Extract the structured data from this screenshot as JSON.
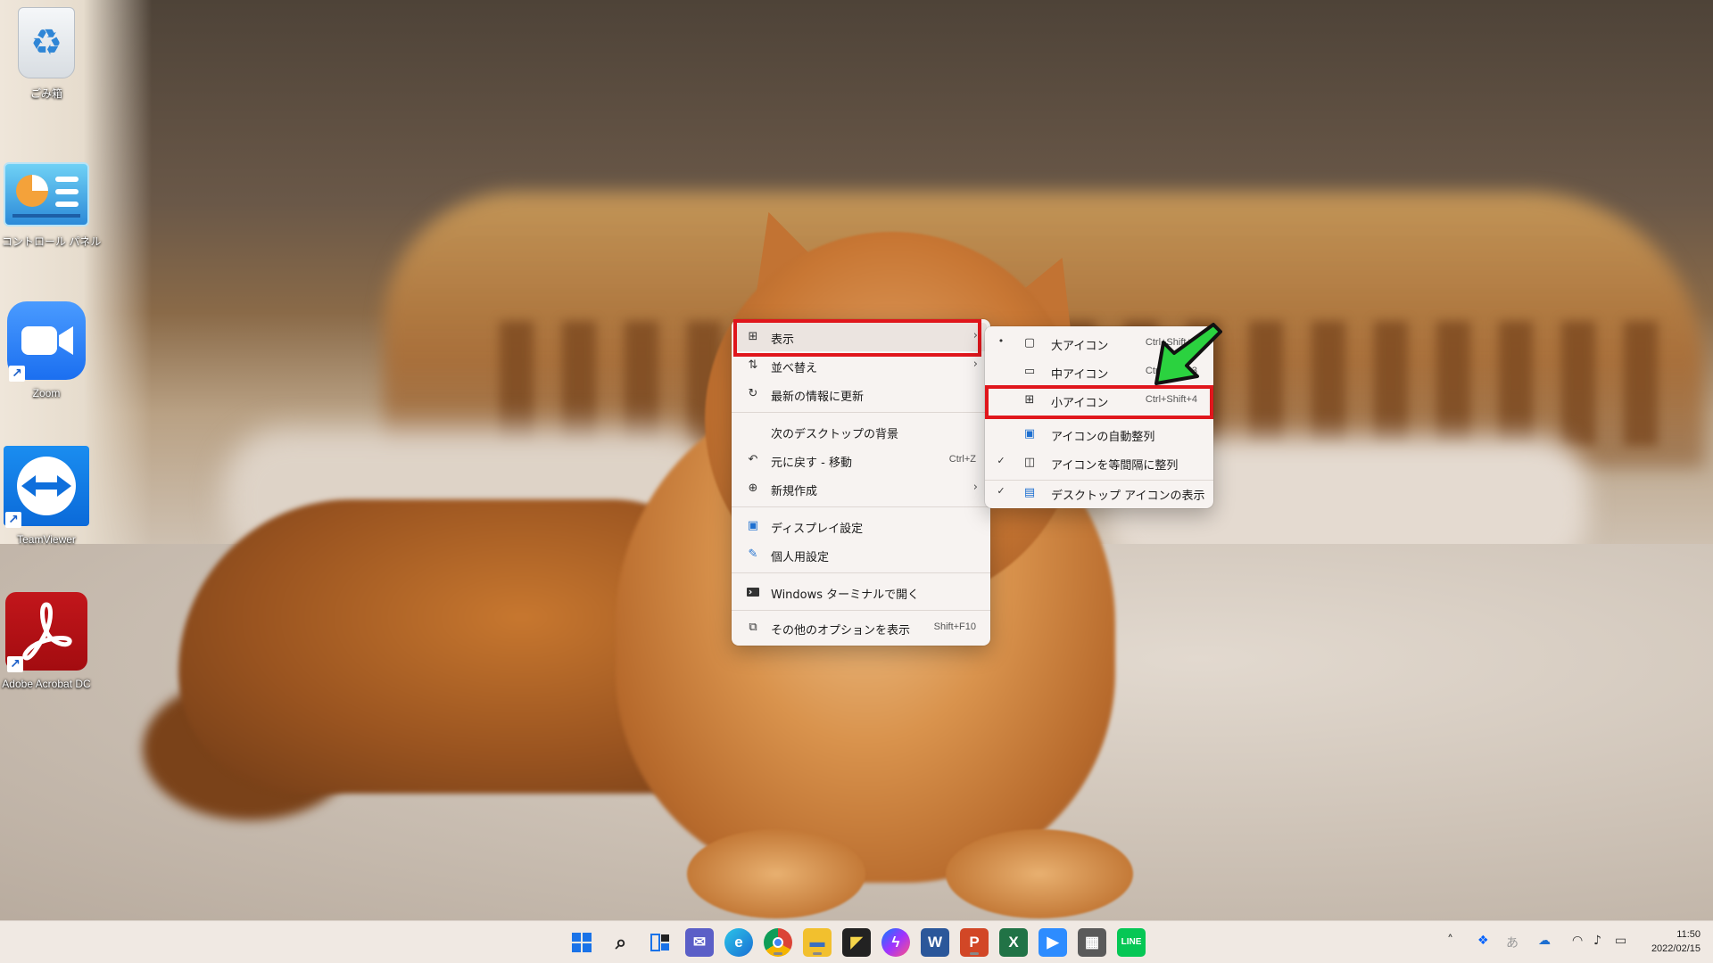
{
  "desktop": {
    "icons": [
      {
        "label": "ごみ箱",
        "icon": "recycle-bin-icon"
      },
      {
        "label": "コントロール パネル",
        "icon": "control-panel-icon"
      },
      {
        "label": "Zoom",
        "icon": "zoom-icon"
      },
      {
        "label": "TeamViewer",
        "icon": "teamviewer-icon"
      },
      {
        "label": "Adobe Acrobat DC",
        "icon": "acrobat-icon"
      }
    ]
  },
  "context_menu": {
    "items": [
      {
        "label": "表示",
        "icon": "grid-icon",
        "has_submenu": true
      },
      {
        "label": "並べ替え",
        "icon": "sort-icon",
        "has_submenu": true
      },
      {
        "label": "最新の情報に更新",
        "icon": "refresh-icon"
      },
      {
        "label": "次のデスクトップの背景",
        "icon": ""
      },
      {
        "label": "元に戻す - 移動",
        "icon": "undo-icon",
        "shortcut": "Ctrl+Z"
      },
      {
        "label": "新規作成",
        "icon": "plus-circle-icon",
        "has_submenu": true
      },
      {
        "label": "ディスプレイ設定",
        "icon": "display-icon"
      },
      {
        "label": "個人用設定",
        "icon": "brush-icon"
      },
      {
        "label": "Windows ターミナルで開く",
        "icon": "terminal-icon"
      },
      {
        "label": "その他のオプションを表示",
        "icon": "more-options-icon",
        "shortcut": "Shift+F10"
      }
    ]
  },
  "view_submenu": {
    "items": [
      {
        "label": "大アイコン",
        "shortcut": "Ctrl+Shift+2",
        "marker": "•"
      },
      {
        "label": "中アイコン",
        "shortcut": "Ctrl+Shift+3",
        "marker": ""
      },
      {
        "label": "小アイコン",
        "shortcut": "Ctrl+Shift+4",
        "marker": ""
      },
      {
        "label": "アイコンの自動整列",
        "shortcut": "",
        "marker": ""
      },
      {
        "label": "アイコンを等間隔に整列",
        "shortcut": "",
        "marker": "✓"
      },
      {
        "label": "デスクトップ アイコンの表示",
        "shortcut": "",
        "marker": "✓"
      }
    ]
  },
  "taskbar": {
    "apps": [
      "start",
      "search",
      "task-view",
      "chat",
      "edge",
      "chrome",
      "file-explorer",
      "sticky-notes",
      "messenger",
      "word",
      "powerpoint",
      "excel",
      "zoom",
      "calculator",
      "line"
    ],
    "clock_time": "11:50",
    "clock_date": "2022/02/15"
  },
  "colors": {
    "highlight_box": "#e0161c",
    "arrow_fill": "#2bd23f"
  }
}
